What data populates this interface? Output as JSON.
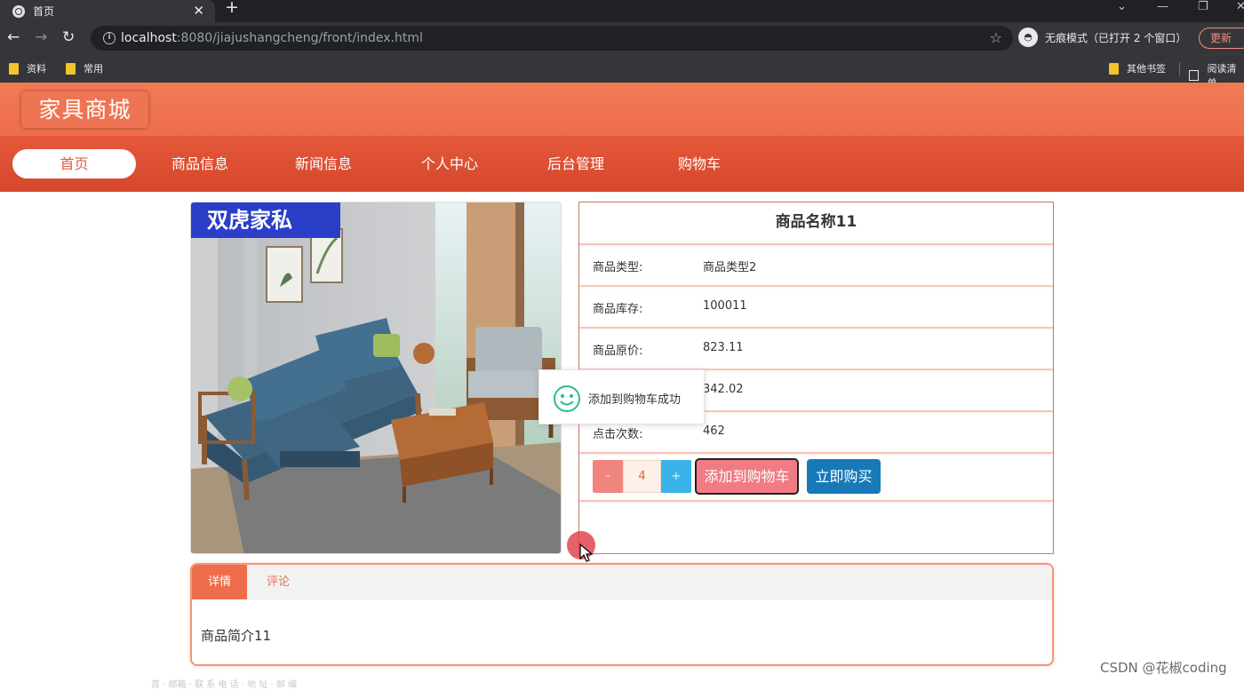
{
  "browser": {
    "tab_title": "首页",
    "tab_close": "✕",
    "new_tab": "+",
    "window_controls": [
      "⌄",
      "—",
      "❐",
      "✕"
    ],
    "nav": {
      "back": "←",
      "forward": "→",
      "reload": "↻"
    },
    "url_host": "localhost",
    "url_rest": ":8080/jiajushangcheng/front/index.html",
    "bookmark_star": "☆",
    "incognito_text": "无痕模式（已打开 2 个窗口）",
    "update_label": "更新",
    "bookmarks": [
      "资料",
      "常用"
    ],
    "bookmarks_right": [
      "其他书签",
      "阅读清单"
    ]
  },
  "site": {
    "logo": "家具商城",
    "nav": [
      "首页",
      "商品信息",
      "新闻信息",
      "个人中心",
      "后台管理",
      "购物车"
    ],
    "active_nav": "首页"
  },
  "product": {
    "image_banner": "双虎家私",
    "name": "商品名称11",
    "rows": [
      {
        "label": "商品类型:",
        "value": "商品类型2"
      },
      {
        "label": "商品库存:",
        "value": "100011"
      },
      {
        "label": "商品原价:",
        "value": "823.11"
      },
      {
        "label": "",
        "value": "342.02"
      },
      {
        "label": "点击次数:",
        "value": "462"
      }
    ],
    "qty_minus": "-",
    "qty_value": "4",
    "qty_plus": "+",
    "add_to_cart_label": "添加到购物车",
    "buy_now_label": "立即购买"
  },
  "toast": {
    "message": "添加到购物车成功",
    "icon": "smile-icon",
    "color": "#2bbd8a"
  },
  "detail_tabs": {
    "tabs": [
      "详情",
      "评论"
    ],
    "active": "详情",
    "content": "商品简介11"
  },
  "footer_faint": "首 · 邮箱 · 联 系 电 话 · 地 址 · 邮 编",
  "watermark": "CSDN @花椒coding",
  "colors": {
    "header": "#ef7453",
    "nav": "#dc4f33",
    "accent": "#ee6e4c",
    "buy": "#1779b8",
    "cart": "#f07b84"
  }
}
